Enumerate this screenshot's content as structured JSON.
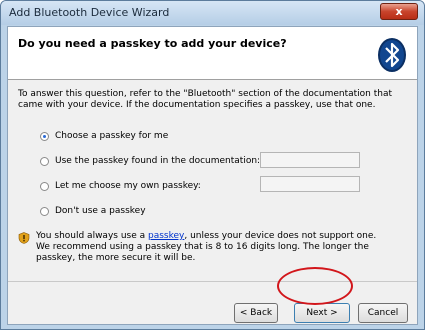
{
  "window": {
    "title": "Add Bluetooth Device Wizard",
    "close_glyph": "x"
  },
  "header": {
    "question": "Do you need a passkey to add your device?"
  },
  "description": "To answer this question, refer to the \"Bluetooth\" section of the documentation that came with your device. If the documentation specifies a passkey, use that one.",
  "options": [
    {
      "label": "Choose a passkey for me",
      "checked": true
    },
    {
      "label": "Use the passkey found in the documentation:",
      "checked": false
    },
    {
      "label": "Let me choose my own passkey:",
      "checked": false
    },
    {
      "label": "Don't use a passkey",
      "checked": false
    }
  ],
  "note": {
    "before_link": "You should always use a ",
    "link": "passkey",
    "after_link": ", unless your device does not support one. We recommend using a passkey that is 8 to 16 digits long. The longer the passkey, the more secure it will be."
  },
  "buttons": {
    "back": "< Back",
    "next": "Next >",
    "cancel": "Cancel"
  },
  "colors": {
    "accent": "#2b6ad6",
    "link": "#0033cc",
    "highlight": "#d2161b"
  },
  "icons": {
    "logo": "bluetooth-icon",
    "note": "shield-warning-icon"
  }
}
